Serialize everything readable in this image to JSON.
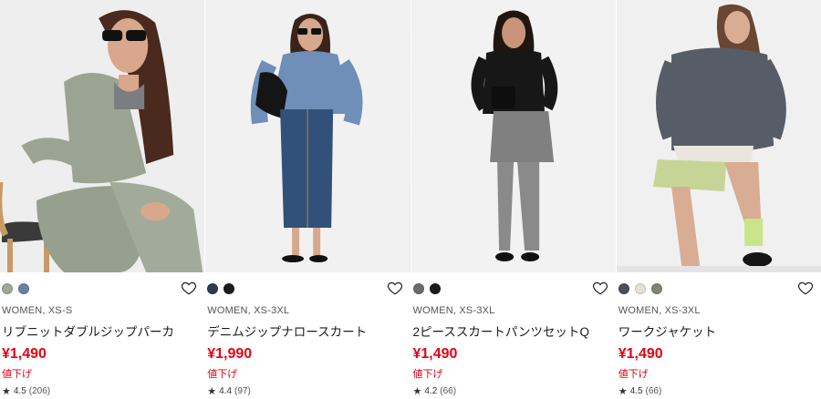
{
  "products": [
    {
      "swatches": [
        "#9ea896",
        "#6d7fa6"
      ],
      "meta": "WOMEN, XS-S",
      "name": "リブニットダブルジップパーカ",
      "price": "¥1,490",
      "tag": "値下げ",
      "rating": "4.5",
      "count": "(206)",
      "image_alt": "woman in sage ribbed knit set seated on chair"
    },
    {
      "swatches": [
        "#2c3b52",
        "#1c1c1c"
      ],
      "meta": "WOMEN, XS-3XL",
      "name": "デニムジップナロースカート",
      "price": "¥1,990",
      "tag": "値下げ",
      "rating": "4.4",
      "count": "(97)",
      "image_alt": "woman in denim shirt and long denim skirt"
    },
    {
      "swatches": [
        "#6b6b6b",
        "#1c1c1c"
      ],
      "meta": "WOMEN, XS-3XL",
      "name": "2ピーススカートパンツセットQ",
      "price": "¥1,490",
      "tag": "値下げ",
      "rating": "4.2",
      "count": "(66)",
      "image_alt": "woman in black top and grey skirt pants set"
    },
    {
      "swatches": [
        "#4a5058",
        "#e5e0d4",
        "#7f8670"
      ],
      "meta": "WOMEN, XS-3XL",
      "name": "ワークジャケット",
      "price": "¥1,490",
      "tag": "値下げ",
      "rating": "4.5",
      "count": "(66)",
      "image_alt": "woman in grey work jacket and green shorts"
    }
  ],
  "icons": {
    "favorite": "heart-outline-icon",
    "rating": "star-icon"
  }
}
